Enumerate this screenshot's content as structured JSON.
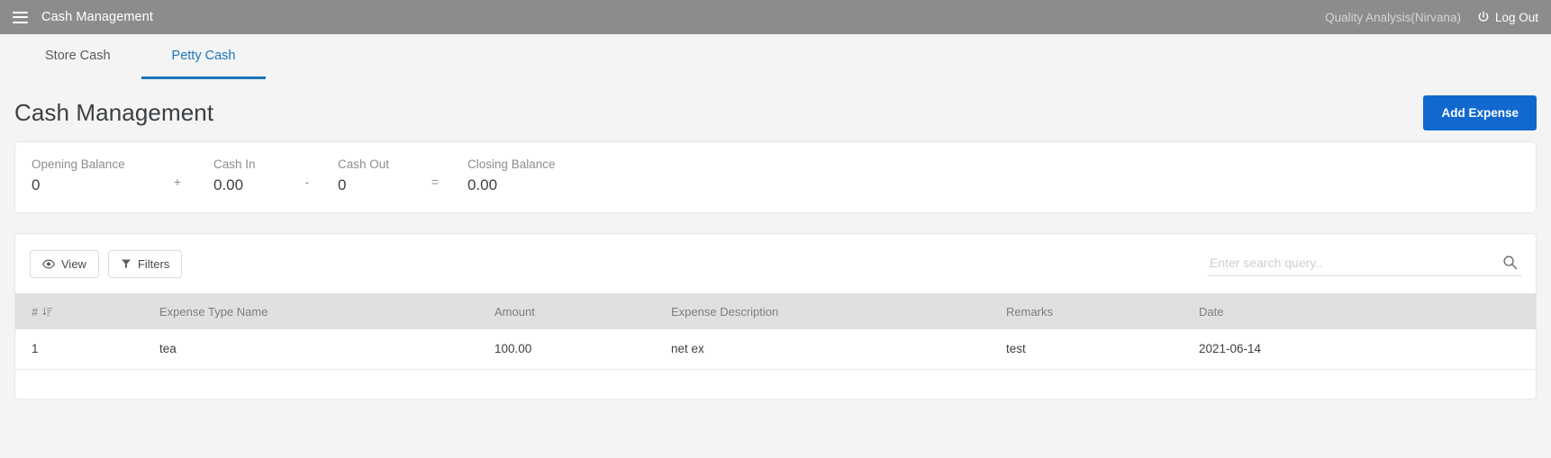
{
  "topbar": {
    "menu_icon": "hamburger-icon",
    "title": "Cash Management",
    "user": "Quality Analysis(Nirvana)",
    "logout_icon": "power-icon",
    "logout_label": "Log Out"
  },
  "tabs": [
    {
      "label": "Store Cash",
      "active": false
    },
    {
      "label": "Petty Cash",
      "active": true
    }
  ],
  "page": {
    "title": "Cash Management",
    "add_button": "Add Expense"
  },
  "balance": {
    "items": [
      {
        "label": "Opening Balance",
        "value": "0"
      },
      {
        "label": "Cash In",
        "value": "0.00"
      },
      {
        "label": "Cash Out",
        "value": "0"
      },
      {
        "label": "Closing Balance",
        "value": "0.00"
      }
    ],
    "operators": [
      "+",
      "-",
      "="
    ]
  },
  "toolbar": {
    "view_label": "View",
    "view_icon": "eye-icon",
    "filters_label": "Filters",
    "filters_icon": "funnel-icon",
    "search_placeholder": "Enter search query..",
    "search_value": "",
    "search_icon": "search-icon"
  },
  "table": {
    "columns": [
      "#",
      "Expense Type Name",
      "Amount",
      "Expense Description",
      "Remarks",
      "Date"
    ],
    "sort_icon": "sort-descending-icon",
    "rows": [
      {
        "index": "1",
        "type": "tea",
        "amount": "100.00",
        "description": "net ex",
        "remarks": "test",
        "date": "2021-06-14"
      }
    ]
  },
  "colors": {
    "topbar_bg": "#8c8c8c",
    "accent": "#1b75bb",
    "primary_button": "#1168cf",
    "page_bg": "#f4f4f4",
    "table_header_bg": "#e0e0e0"
  }
}
